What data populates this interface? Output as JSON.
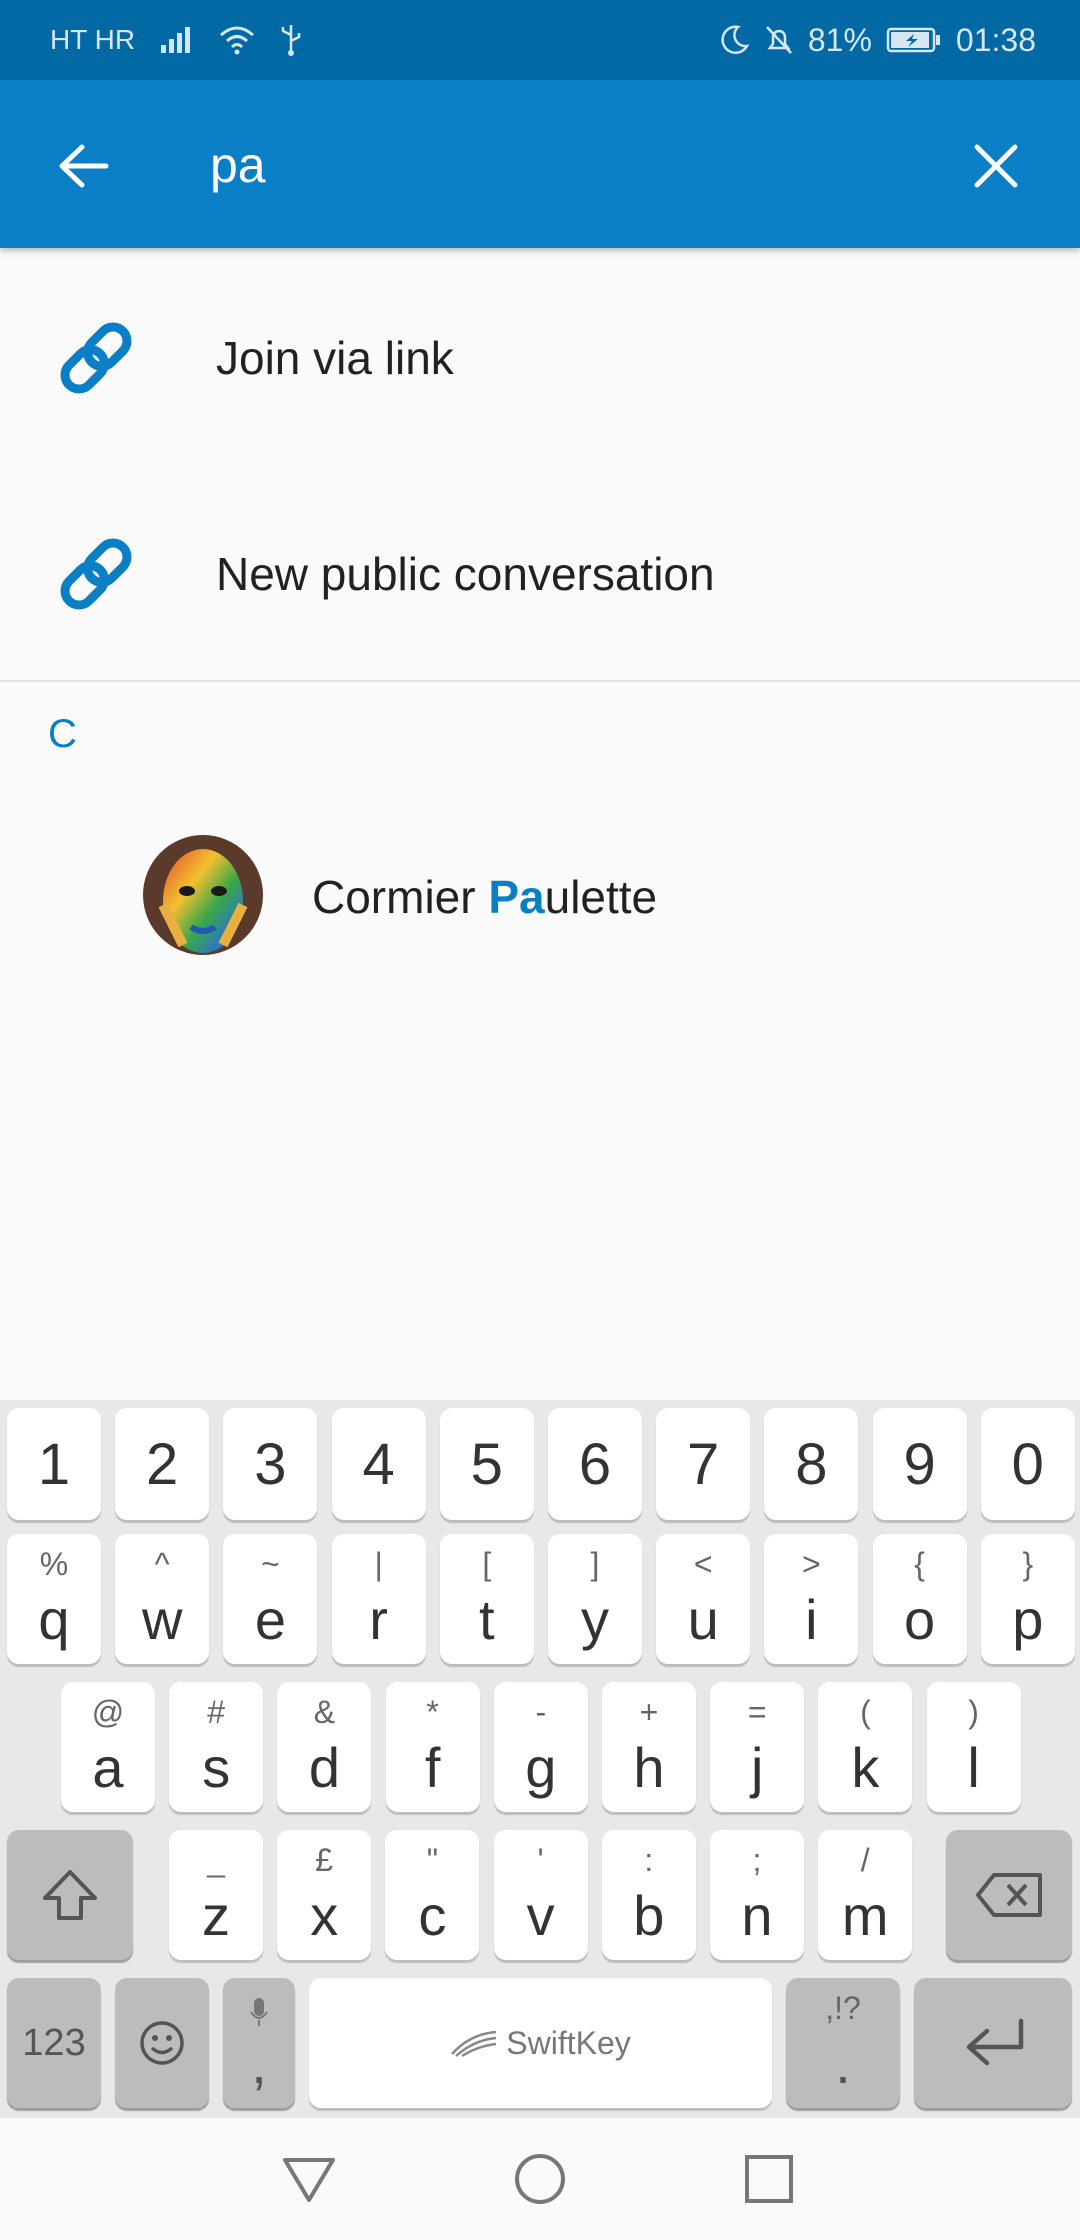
{
  "status_bar": {
    "carrier": "HT HR",
    "battery": "81%",
    "time": "01:38",
    "icons": [
      "signal-icon",
      "wifi-icon",
      "usb-icon",
      "moon-icon",
      "bell-off-icon",
      "battery-charging-icon"
    ]
  },
  "search": {
    "query": "pa",
    "back_icon": "arrow-left-icon",
    "clear_icon": "close-icon"
  },
  "actions": [
    {
      "label": "Join via link",
      "icon": "link-icon"
    },
    {
      "label": "New public conversation",
      "icon": "link-icon"
    }
  ],
  "contacts_section": {
    "letter": "C",
    "contacts": [
      {
        "name_before": "Cormier ",
        "name_match": "Pa",
        "name_after": "ulette",
        "avatar": "avatar-image"
      }
    ]
  },
  "keyboard": {
    "row1": [
      "1",
      "2",
      "3",
      "4",
      "5",
      "6",
      "7",
      "8",
      "9",
      "0"
    ],
    "row2": [
      [
        "q",
        "%"
      ],
      [
        "w",
        "^"
      ],
      [
        "e",
        "~"
      ],
      [
        "r",
        "|"
      ],
      [
        "t",
        "["
      ],
      [
        "y",
        "]"
      ],
      [
        "u",
        "<"
      ],
      [
        "i",
        ">"
      ],
      [
        "o",
        "{"
      ],
      [
        "p",
        "}"
      ]
    ],
    "row3": [
      [
        "a",
        "@"
      ],
      [
        "s",
        "#"
      ],
      [
        "d",
        "&"
      ],
      [
        "f",
        "*"
      ],
      [
        "g",
        "-"
      ],
      [
        "h",
        "+"
      ],
      [
        "j",
        "="
      ],
      [
        "k",
        "("
      ],
      [
        "l",
        ")"
      ]
    ],
    "row4": [
      [
        "z",
        "_"
      ],
      [
        "x",
        "£"
      ],
      [
        "c",
        "\""
      ],
      [
        "v",
        "'"
      ],
      [
        "b",
        ":"
      ],
      [
        "n",
        ";"
      ],
      [
        "m",
        "/"
      ]
    ],
    "numbers_label": "123",
    "comma_label": ",",
    "period_label": ".",
    "period_sub": ",!?",
    "space_label": "SwiftKey"
  },
  "colors": {
    "status_bar": "#0369a4",
    "app_bar": "#0a7fc6",
    "accent": "#0a7fc6"
  }
}
